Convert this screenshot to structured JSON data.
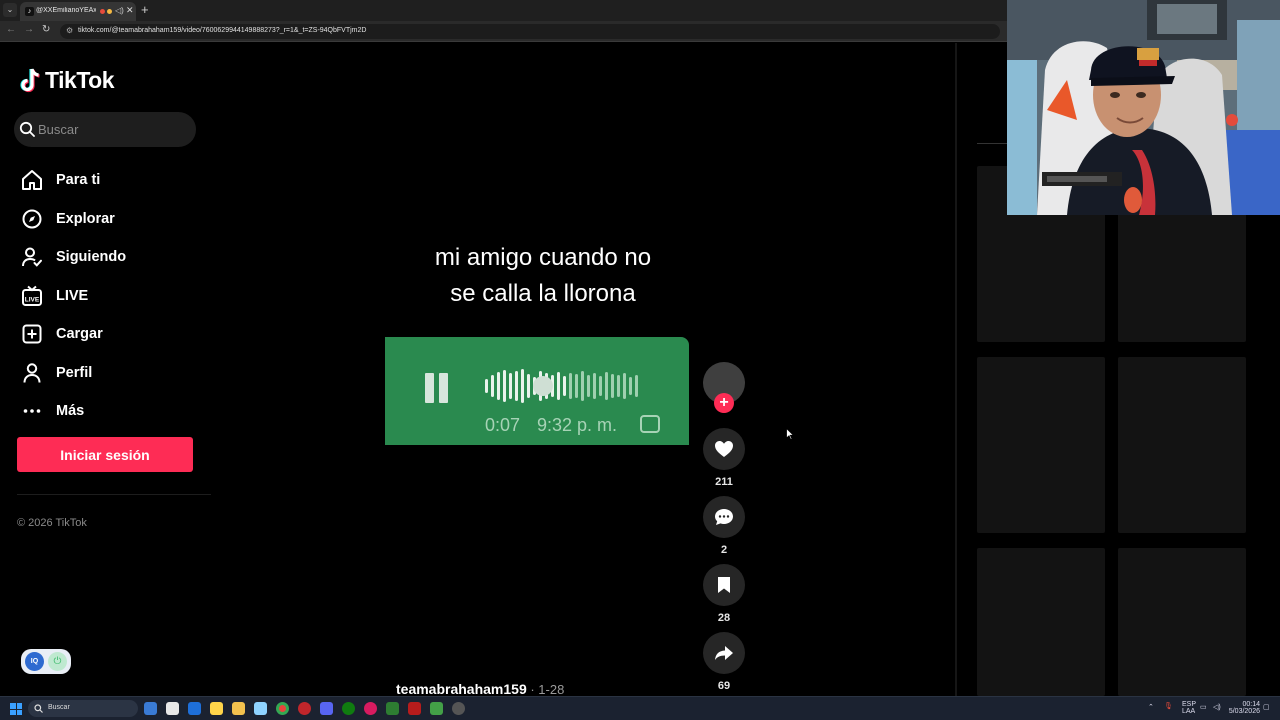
{
  "browser": {
    "tab_title": "@XXEmilianoYEAxX",
    "url": "tiktok.com/@teamabrahaham159/video/7600629944149888273?_r=1&_t=ZS-94QbFVTjm2D"
  },
  "sidebar": {
    "brand": "TikTok",
    "search_placeholder": "Buscar",
    "items": [
      {
        "label": "Para ti",
        "icon": "home-icon"
      },
      {
        "label": "Explorar",
        "icon": "compass-icon"
      },
      {
        "label": "Siguiendo",
        "icon": "following-icon"
      },
      {
        "label": "LIVE",
        "icon": "live-icon"
      },
      {
        "label": "Cargar",
        "icon": "upload-icon"
      },
      {
        "label": "Perfil",
        "icon": "profile-icon"
      },
      {
        "label": "Más",
        "icon": "more-icon"
      }
    ],
    "login_label": "Iniciar sesión",
    "copyright": "© 2026 TikTok"
  },
  "video": {
    "caption_line1": "mi amigo cuando no",
    "caption_line2": "se calla la llorona",
    "voice_duration": "0:07",
    "voice_time": "9:32 p. m.",
    "colors": {
      "bubble": "#2a8a4f",
      "accent": "#fe2c55"
    }
  },
  "actions": {
    "likes": "211",
    "comments": "2",
    "saves": "28",
    "shares": "69"
  },
  "author": {
    "username": "teamabrahaham159",
    "date": " · 1-28"
  },
  "taskbar": {
    "search_label": "Buscar",
    "lang_top": "ESP",
    "lang_bottom": "LAA",
    "time": "00:14",
    "date": "5/03/2026"
  }
}
